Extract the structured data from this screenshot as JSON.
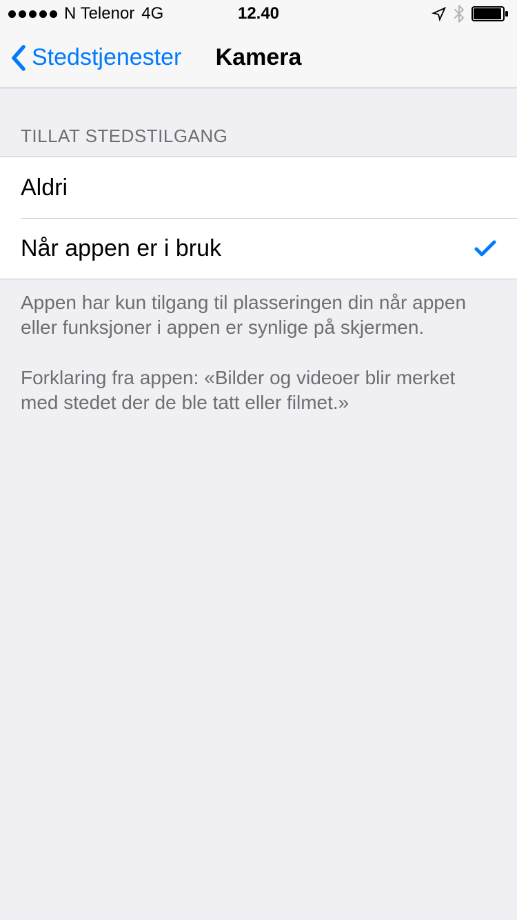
{
  "status_bar": {
    "carrier": "N Telenor",
    "network": "4G",
    "time": "12.40"
  },
  "nav": {
    "back_label": "Stedstjenester",
    "title": "Kamera"
  },
  "section": {
    "header": "TILLAT STEDSTILGANG",
    "options": [
      {
        "label": "Aldri",
        "selected": false
      },
      {
        "label": "Når appen er i bruk",
        "selected": true
      }
    ]
  },
  "footer": {
    "line1": "Appen har kun tilgang til plasseringen din når appen eller funksjoner i appen er synlige på skjermen.",
    "line2": "Forklaring fra appen: «Bilder og videoer blir merket med stedet der de ble tatt eller filmet.»"
  },
  "colors": {
    "tint": "#007AFF"
  }
}
